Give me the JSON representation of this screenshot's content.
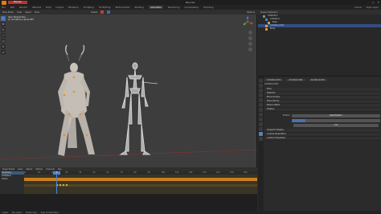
{
  "window": {
    "title": "Blender",
    "red_button_label": "Blender",
    "controls": [
      "–",
      "□",
      "✕"
    ]
  },
  "menubar": {
    "items": [
      "File",
      "Edit",
      "Render",
      "Window",
      "Help"
    ],
    "workspaces": [
      "Layout",
      "Modeling",
      "Sculpting",
      "UV Editing",
      "Texture Paint",
      "Shading",
      "Animation",
      "Rendering",
      "Compositing",
      "Scripting"
    ],
    "active_workspace": "Animation",
    "scene": "Scene",
    "view_layer": "View Layer"
  },
  "viewport": {
    "header_items": [
      "Pose Mode",
      "View",
      "Select",
      "Pose",
      "Global",
      "Options"
    ],
    "info_lines": [
      "User Perspective",
      "(1) Armature | spine.003"
    ],
    "tools": [
      "cursor",
      "move",
      "rotate",
      "scale",
      "transform",
      "annotate",
      "measure"
    ]
  },
  "timeline": {
    "header_items": [
      "Dope Sheet",
      "View",
      "Select",
      "Marker",
      "Channel",
      "Key"
    ],
    "ruler": [
      "0",
      "10",
      "20",
      "30",
      "40",
      "50",
      "60",
      "70",
      "80",
      "90",
      "100",
      "110",
      "120",
      "130",
      "140",
      "150",
      "160"
    ],
    "current_frame": "0",
    "channels": [
      {
        "label": "Summary",
        "selected": true
      },
      {
        "label": "Armature",
        "selected": false
      },
      {
        "label": "Action",
        "selected": false
      }
    ]
  },
  "outliner": {
    "header_items": [
      "Scene Collection"
    ],
    "rows": [
      {
        "label": "Collection",
        "selected": false,
        "color": "#8a8a8a"
      },
      {
        "label": "Armature",
        "selected": false,
        "color": "#3d8fb3"
      },
      {
        "label": "Pose",
        "selected": false,
        "color": "#d89b3a"
      },
      {
        "label": "Armature.001",
        "selected": true,
        "color": "#d89b3a"
      },
      {
        "label": "Body",
        "selected": false,
        "color": "#e0923a"
      }
    ]
  },
  "properties": {
    "tabs": [
      "tool",
      "render",
      "output",
      "view",
      "scene",
      "world",
      "object",
      "modifiers",
      "particles",
      "physics",
      "constraints",
      "data",
      "bone"
    ],
    "head": [
      "Armature.001",
      "Armature.001",
      "Armature.001"
    ],
    "path": "Armature.001",
    "sections": [
      "Pose",
      "Skeleton",
      "Bone Groups",
      "Pose Library",
      "Motion Paths",
      "Display",
      "Viewport Display",
      "Inverse Kinematics",
      "Custom Properties"
    ],
    "field1": {
      "label": "Position",
      "value": "Rest Position"
    },
    "slider_fraction": 0.15,
    "button": "Add"
  },
  "statusbar": [
    "Select",
    "Box Select",
    "Rotate View",
    "Pose Context Menu"
  ],
  "colors": {
    "accent": "#4a87d6",
    "orange": "#c9801f",
    "red": "#c2302c"
  }
}
